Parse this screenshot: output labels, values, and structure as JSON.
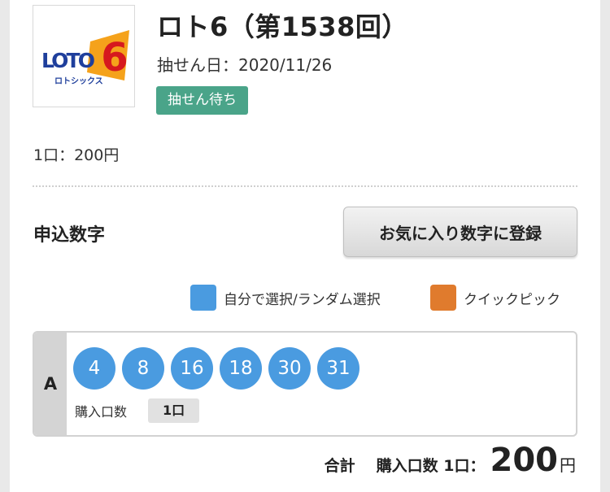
{
  "header": {
    "logo": {
      "wordmark": "LOTO",
      "digit": "6",
      "kana": "ロトシックス"
    },
    "title": "ロト6（第1538回）",
    "draw_date": "抽せん日：2020/11/26",
    "status": "抽せん待ち"
  },
  "price_per": "1口：200円",
  "numbers_section": {
    "title": "申込数字",
    "favorite_button": "お気に入り数字に登録"
  },
  "legend": [
    {
      "label": "自分で選択/ランダム選択",
      "color": "#4a9be0"
    },
    {
      "label": "クイックピック",
      "color": "#e07b2d"
    }
  ],
  "entries": [
    {
      "letter": "A",
      "numbers": [
        "4",
        "8",
        "16",
        "18",
        "30",
        "31"
      ],
      "ball_color": "#4a9be0",
      "qty_label": "購入口数",
      "qty": "1口"
    }
  ],
  "total": {
    "label": "合計",
    "count": "購入口数 1口：",
    "amount": "200",
    "unit": "円"
  }
}
